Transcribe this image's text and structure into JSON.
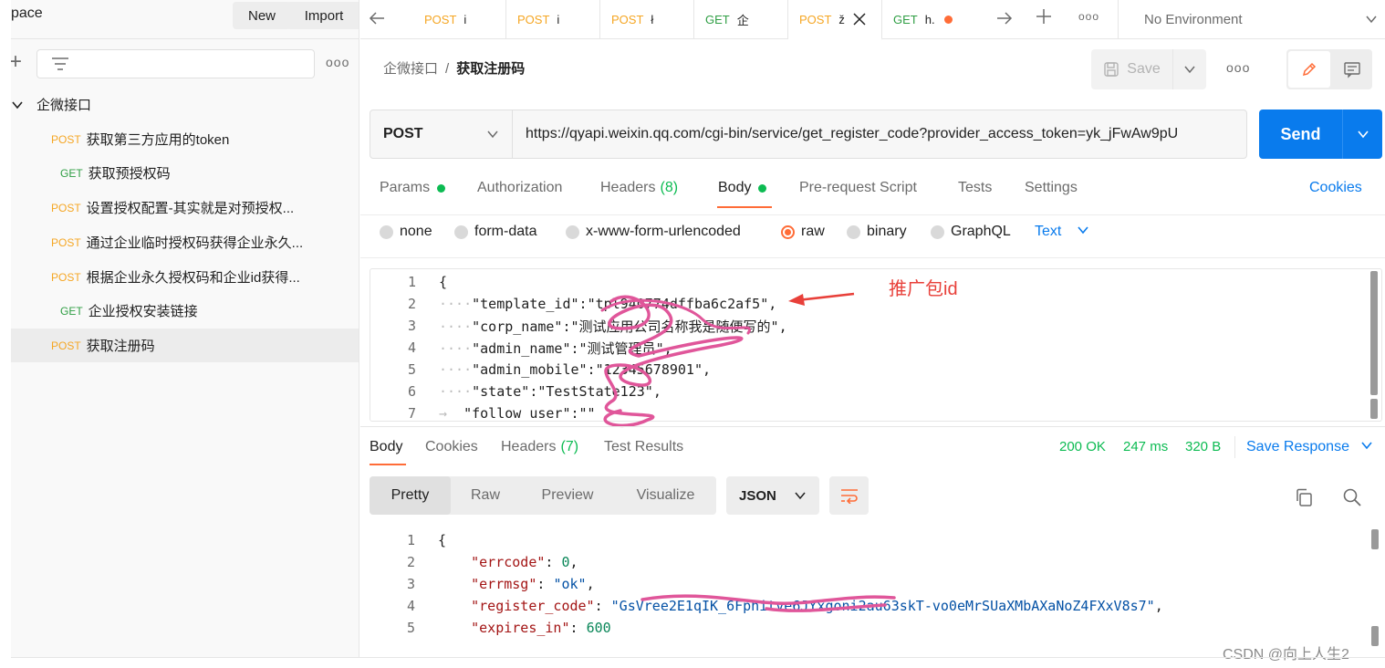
{
  "sidebar": {
    "workspace_title": "pace",
    "new_label": "New",
    "import_label": "Import",
    "more_label": "ooo",
    "collection": {
      "name": "企微接口",
      "items": [
        {
          "method": "POST",
          "name": "获取第三方应用的token"
        },
        {
          "method": "GET",
          "name": "获取预授权码"
        },
        {
          "method": "POST",
          "name": "设置授权配置-其实就是对预授权..."
        },
        {
          "method": "POST",
          "name": "通过企业临时授权码获得企业永久..."
        },
        {
          "method": "POST",
          "name": "根据企业永久授权码和企业id获得..."
        },
        {
          "method": "GET",
          "name": "企业授权安装链接"
        },
        {
          "method": "POST",
          "name": "获取注册码"
        }
      ]
    }
  },
  "tabs": {
    "items": [
      {
        "method": "POST",
        "name": "i"
      },
      {
        "method": "POST",
        "name": "i"
      },
      {
        "method": "POST",
        "name": "ł"
      },
      {
        "method": "GET",
        "name": "企"
      },
      {
        "method": "POST",
        "name": "ž"
      },
      {
        "method": "GET",
        "name": "h."
      }
    ],
    "more_label": "ooo",
    "environment": "No Environment"
  },
  "request": {
    "breadcrumb_parent": "企微接口",
    "breadcrumb_sep": "/",
    "breadcrumb_current": "获取注册码",
    "save_label": "Save",
    "more_label": "ooo",
    "method": "POST",
    "url": "https://qyapi.weixin.qq.com/cgi-bin/service/get_register_code?provider_access_token=yk_jFwAw9pU",
    "send_label": "Send",
    "tabs": {
      "params": "Params",
      "authorization": "Authorization",
      "headers": "Headers",
      "headers_count": "(8)",
      "body": "Body",
      "prerequest": "Pre-request Script",
      "tests": "Tests",
      "settings": "Settings",
      "cookies": "Cookies"
    },
    "body_types": {
      "none": "none",
      "form_data": "form-data",
      "urlencoded": "x-www-form-urlencoded",
      "raw": "raw",
      "binary": "binary",
      "graphql": "GraphQL",
      "language": "Text"
    },
    "code_lines": {
      "l1": "{",
      "l2_key": "\"template_id\":",
      "l2_val": "\"tpl940774dffba6c2af5\"",
      "l2_tail": ",",
      "l3_key": "\"corp_name\":",
      "l3_val": "\"测试应用公司名称我是随便写的\"",
      "l3_tail": ",",
      "l4_key": "\"admin_name\":",
      "l4_val": "\"测试管理员\"",
      "l4_tail": ",",
      "l5_key": "\"admin_mobile\":",
      "l5_val": "\"12345678901\"",
      "l5_tail": ",",
      "l6_key": "\"state\":",
      "l6_val": "\"TestState123\"",
      "l6_tail": ",",
      "l7_key": "\"follow_user\":",
      "l7_val": "\"\""
    },
    "annotation": "推广包id"
  },
  "response": {
    "tabs": {
      "body": "Body",
      "cookies": "Cookies",
      "headers": "Headers",
      "headers_count": "(7)",
      "test_results": "Test Results"
    },
    "status": "200 OK",
    "time": "247 ms",
    "size": "320 B",
    "save_label": "Save Response",
    "views": [
      "Pretty",
      "Raw",
      "Preview",
      "Visualize"
    ],
    "format": "JSON",
    "code_lines": {
      "l1": "{",
      "l2_key": "\"errcode\"",
      "l2_val": "0",
      "l3_key": "\"errmsg\"",
      "l3_val": "\"ok\"",
      "l4_key": "\"register_code\"",
      "l4_val": "\"GsVree2E1qIK_6Fphitve6JYxgoni2au63skT-vo0eMrSUaXMbAXaNoZ4FXxV8s7\"",
      "l5_key": "\"expires_in\"",
      "l5_val": "600"
    }
  },
  "watermark": "CSDN @向上人生2",
  "colors": {
    "accent": "#ff6c37",
    "primary": "#097bed",
    "success": "#0cbb52",
    "post": "#f5a623",
    "get": "#2f9e44",
    "annotation": "#e8403a",
    "scribble": "#e0569a"
  }
}
